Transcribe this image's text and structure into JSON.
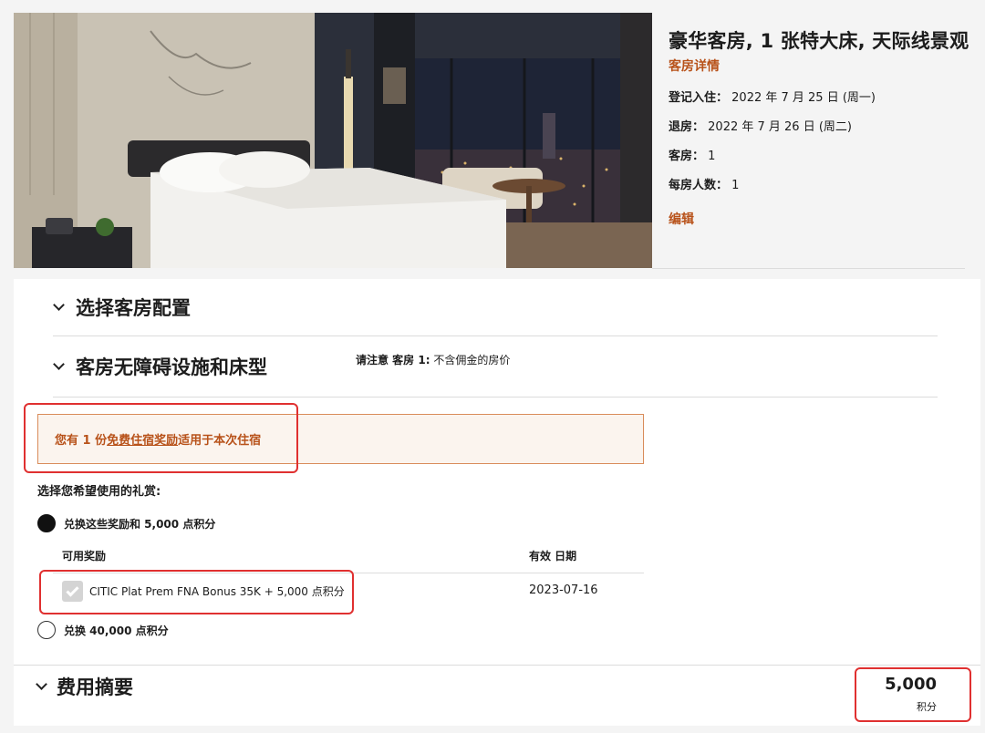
{
  "room": {
    "title": "豪华客房, 1 张特大床, 天际线景观",
    "details_link": "客房详情",
    "checkin_label": "登记入住：",
    "checkin_value": "2022 年 7 月 25 日 (周一)",
    "checkout_label": "退房：",
    "checkout_value": "2022 年 7 月 26 日 (周二)",
    "rooms_label": "客房：",
    "rooms_value": "1",
    "guests_label": "每房人数：",
    "guests_value": "1",
    "edit_link": "编辑"
  },
  "sections": {
    "room_config": "选择客房配置",
    "accessibility": "客房无障碍设施和床型",
    "fee_summary": "费用摘要"
  },
  "notice": {
    "label": "请注意 客房 1:",
    "text": "不含佣金的房价"
  },
  "award_alert": {
    "prefix": "您有 1 份",
    "link": "免费住宿奖励",
    "suffix": "适用于本次住宿"
  },
  "reward_choice": {
    "label": "选择您希望使用的礼赏:",
    "option_1": "兑换这些奖励和 5,000 点积分",
    "option_1_selected": true,
    "option_2": "兑换 40,000 点积分",
    "option_2_selected": false,
    "table_header_reward": "可用奖励",
    "table_header_expiry": "有效 日期",
    "reward_name": "CITIC Plat Prem FNA Bonus 35K + 5,000 点积分",
    "reward_checked": true,
    "reward_expiry": "2023-07-16"
  },
  "summary": {
    "total": "5,000",
    "unit": "积分"
  },
  "colors": {
    "accent": "#b8521a",
    "highlight_outline": "#e03030",
    "alert_bg": "#fbf4ee",
    "alert_border": "#d98c5a"
  }
}
